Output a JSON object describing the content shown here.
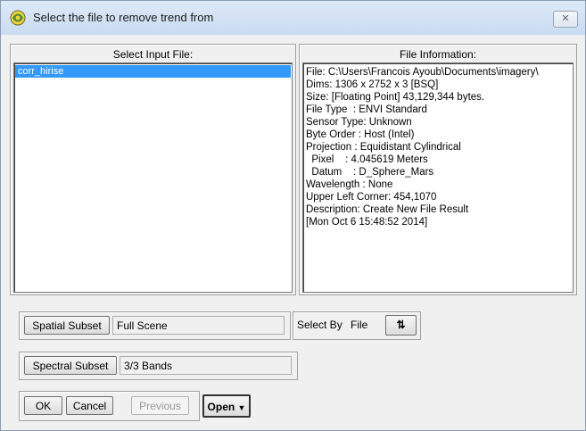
{
  "window": {
    "title": "Select the file to remove trend from",
    "close_icon": "close-icon"
  },
  "input_panel": {
    "title": "Select Input File:",
    "files": [
      "corr_hirise"
    ],
    "selected_index": 0
  },
  "info_panel": {
    "title": "File Information:",
    "lines": [
      "File: C:\\Users\\Francois Ayoub\\Documents\\imagery\\",
      "Dims: 1306 x 2752 x 3 [BSQ]",
      "Size: [Floating Point] 43,129,344 bytes.",
      "File Type  : ENVI Standard",
      "Sensor Type: Unknown",
      "Byte Order : Host (Intel)",
      "Projection : Equidistant Cylindrical",
      "  Pixel    : 4.045619 Meters",
      "  Datum    : D_Sphere_Mars",
      "Wavelength : None",
      "Upper Left Corner: 454,1070",
      "Description: Create New File Result",
      "[Mon Oct 6 15:48:52 2014]"
    ]
  },
  "spatial_subset": {
    "button_label": "Spatial Subset",
    "value": "Full Scene"
  },
  "select_by": {
    "label": "Select By",
    "value": "File",
    "sort_icon": "sort-arrows-icon"
  },
  "spectral_subset": {
    "button_label": "Spectral Subset",
    "value": "3/3 Bands"
  },
  "buttons": {
    "ok": "OK",
    "cancel": "Cancel",
    "previous": "Previous",
    "open": "Open"
  }
}
